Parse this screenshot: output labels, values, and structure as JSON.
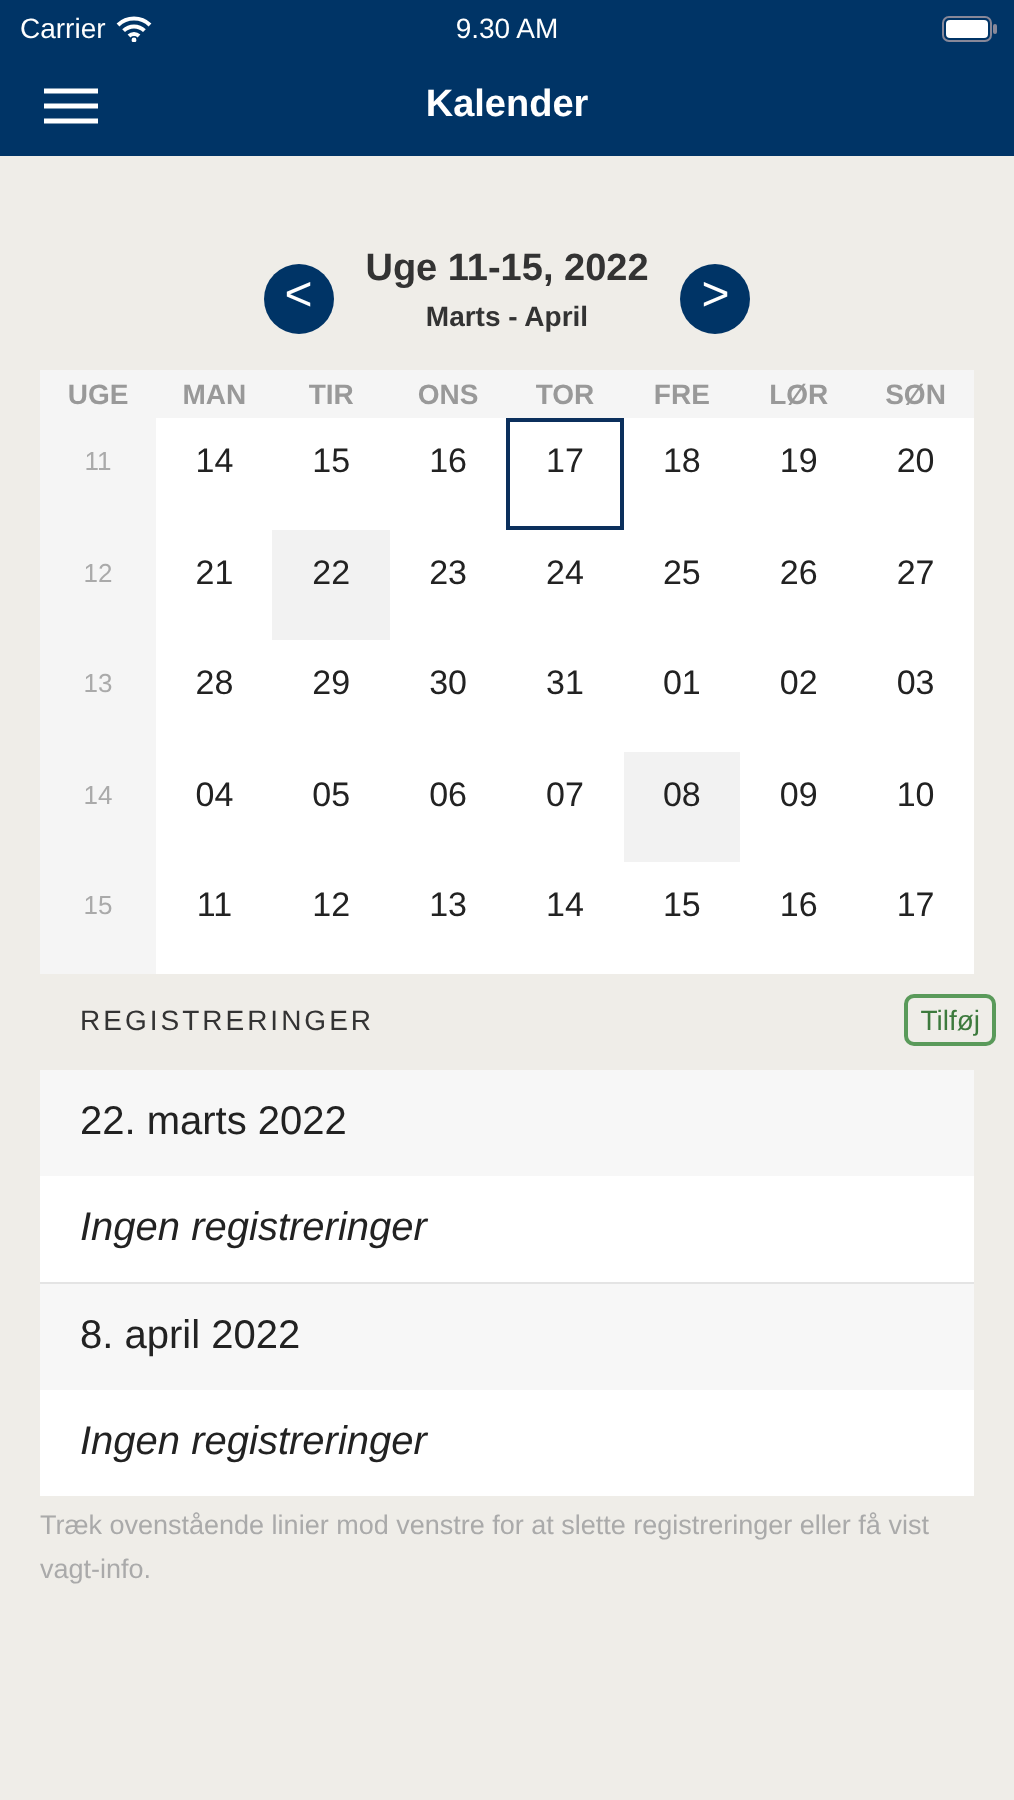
{
  "status_bar": {
    "carrier": "Carrier",
    "time": "9.30 AM"
  },
  "nav": {
    "title": "Kalender"
  },
  "period": {
    "title": "Uge 11-15, 2022",
    "subtitle": "Marts - April",
    "prev": "<",
    "next": ">"
  },
  "calendar": {
    "week_header": "UGE",
    "weekdays": [
      "MAN",
      "TIR",
      "ONS",
      "TOR",
      "FRE",
      "LØR",
      "SØN"
    ],
    "weeks": [
      {
        "number": "11",
        "days": [
          {
            "label": "14",
            "selected": false,
            "marked": false
          },
          {
            "label": "15",
            "selected": false,
            "marked": false
          },
          {
            "label": "16",
            "selected": false,
            "marked": false
          },
          {
            "label": "17",
            "selected": true,
            "marked": false
          },
          {
            "label": "18",
            "selected": false,
            "marked": false
          },
          {
            "label": "19",
            "selected": false,
            "marked": false
          },
          {
            "label": "20",
            "selected": false,
            "marked": false
          }
        ]
      },
      {
        "number": "12",
        "days": [
          {
            "label": "21",
            "selected": false,
            "marked": false
          },
          {
            "label": "22",
            "selected": false,
            "marked": true
          },
          {
            "label": "23",
            "selected": false,
            "marked": false
          },
          {
            "label": "24",
            "selected": false,
            "marked": false
          },
          {
            "label": "25",
            "selected": false,
            "marked": false
          },
          {
            "label": "26",
            "selected": false,
            "marked": false
          },
          {
            "label": "27",
            "selected": false,
            "marked": false
          }
        ]
      },
      {
        "number": "13",
        "days": [
          {
            "label": "28",
            "selected": false,
            "marked": false
          },
          {
            "label": "29",
            "selected": false,
            "marked": false
          },
          {
            "label": "30",
            "selected": false,
            "marked": false
          },
          {
            "label": "31",
            "selected": false,
            "marked": false
          },
          {
            "label": "01",
            "selected": false,
            "marked": false
          },
          {
            "label": "02",
            "selected": false,
            "marked": false
          },
          {
            "label": "03",
            "selected": false,
            "marked": false
          }
        ]
      },
      {
        "number": "14",
        "days": [
          {
            "label": "04",
            "selected": false,
            "marked": false
          },
          {
            "label": "05",
            "selected": false,
            "marked": false
          },
          {
            "label": "06",
            "selected": false,
            "marked": false
          },
          {
            "label": "07",
            "selected": false,
            "marked": false
          },
          {
            "label": "08",
            "selected": false,
            "marked": true
          },
          {
            "label": "09",
            "selected": false,
            "marked": false
          },
          {
            "label": "10",
            "selected": false,
            "marked": false
          }
        ]
      },
      {
        "number": "15",
        "days": [
          {
            "label": "11",
            "selected": false,
            "marked": false
          },
          {
            "label": "12",
            "selected": false,
            "marked": false
          },
          {
            "label": "13",
            "selected": false,
            "marked": false
          },
          {
            "label": "14",
            "selected": false,
            "marked": false
          },
          {
            "label": "15",
            "selected": false,
            "marked": false
          },
          {
            "label": "16",
            "selected": false,
            "marked": false
          },
          {
            "label": "17",
            "selected": false,
            "marked": false
          }
        ]
      }
    ]
  },
  "registrations": {
    "heading": "REGISTRERINGER",
    "add_button": "Tilføj",
    "groups": [
      {
        "date": "22. marts 2022",
        "entry": "Ingen registreringer"
      },
      {
        "date": "8. april 2022",
        "entry": "Ingen registreringer"
      }
    ],
    "hint": "Træk ovenstående linier mod venstre for at slette registreringer eller få vist vagt-info."
  }
}
